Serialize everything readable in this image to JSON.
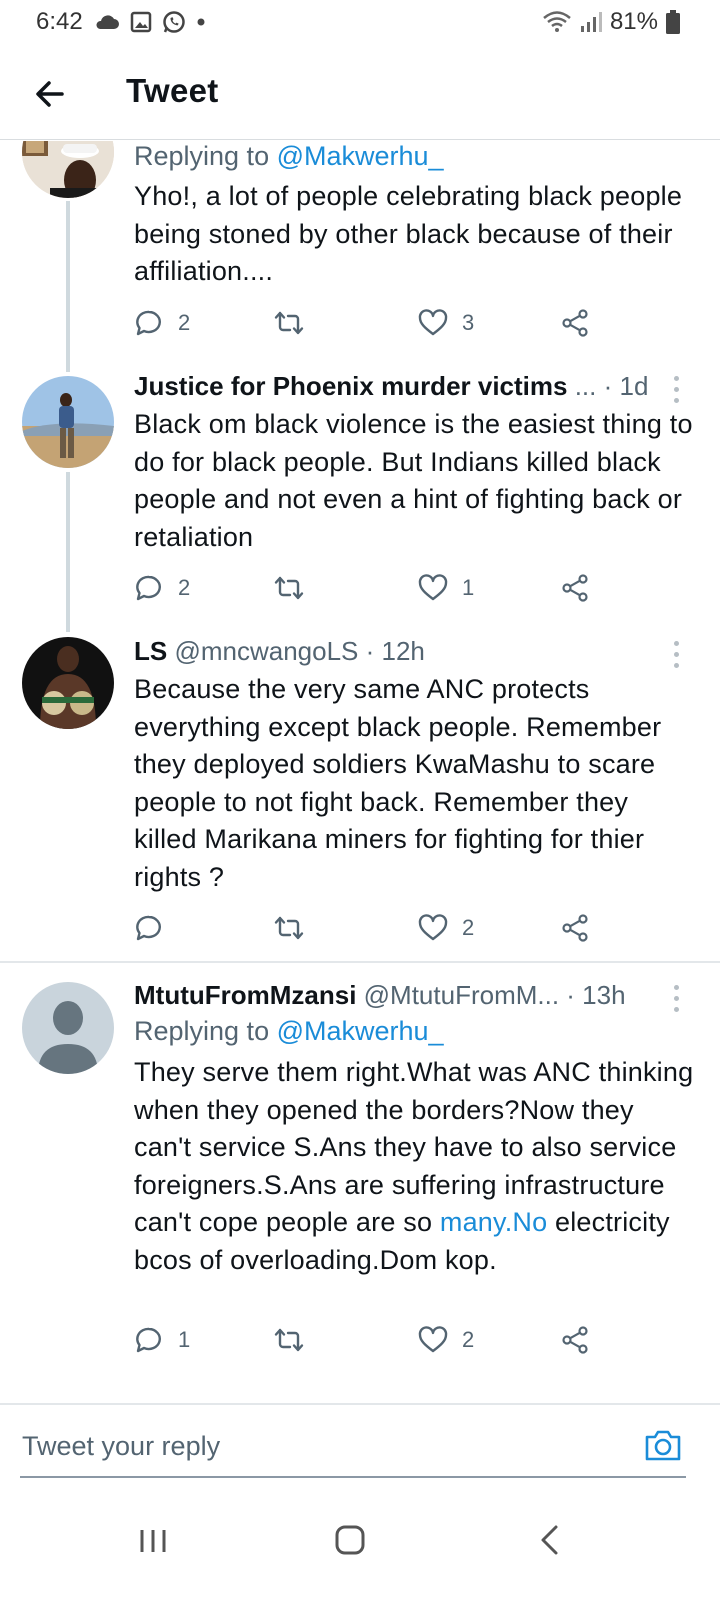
{
  "status_bar": {
    "time": "6:42",
    "battery": "81%",
    "icons": [
      "cloud-icon",
      "gallery-icon",
      "whatsapp-icon",
      "dot-icon",
      "wifi-icon",
      "signal-icon",
      "battery-icon"
    ]
  },
  "header": {
    "title": "Tweet"
  },
  "tweets": [
    {
      "replying_prefix": "Replying to ",
      "replying_handle": "@Makwerhu_",
      "text": "Yho!, a lot of people celebrating black people being stoned by other black because of their affiliation....",
      "replies": "2",
      "retweets": "",
      "likes": "3"
    },
    {
      "name": "Justice for Phoenix murder victims",
      "handle_time": "... · 1d",
      "text": "Black om black violence is the easiest thing to do for black people. But Indians killed black people and not even a hint of fighting back or retaliation",
      "replies": "2",
      "retweets": "",
      "likes": "1"
    },
    {
      "name": "LS",
      "handle": "@mncwangoLS",
      "time": " · 12h",
      "text": "Because the very same ANC protects everything except black people. Remember they deployed soldiers KwaMashu to scare people to not fight back. Remember they killed Marikana miners for fighting for thier rights ?",
      "replies": "",
      "retweets": "",
      "likes": "2"
    },
    {
      "name": "MtutuFromMzansi",
      "handle": "@MtutuFromM...",
      "time": " · 13h",
      "replying_prefix": "Replying to ",
      "replying_handle": "@Makwerhu_",
      "text_before": "They serve them right.What was ANC thinking when they opened the borders?Now they can't service S.Ans they have to also service foreigners.S.Ans are suffering infrastructure can't cope people are so ",
      "text_link": "many.No",
      "text_after": " electricity bcos of overloading.Dom kop.",
      "replies": "1",
      "retweets": "",
      "likes": "2"
    }
  ],
  "reply_bar": {
    "placeholder": "Tweet your reply"
  },
  "colors": {
    "link": "#1a8cd8",
    "muted": "#536471",
    "text": "#0f1419"
  }
}
